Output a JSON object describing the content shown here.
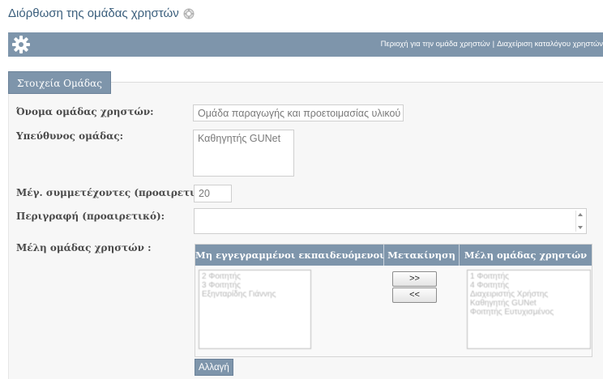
{
  "page": {
    "title": "Διόρθωση της ομάδας χρηστών"
  },
  "toolbar": {
    "link_area": "Περιοχή για την ομάδα χρηστών",
    "separator": "|",
    "link_manage": "Διαχείριση καταλόγου χρηστών"
  },
  "form": {
    "legend": "Στοιχεία Ομάδας",
    "group_name_label": "Όνομα ομάδας χρηστών:",
    "group_name_value": "Ομάδα παραγωγής και προετοιμασίας υλικού",
    "tutor_label": "Υπεύθυνος ομάδας:",
    "tutor_value": "Καθηγητής GUNet",
    "max_label": "Μέγ. συμμετέχοντες (προαιρετικό):",
    "max_value": "20",
    "description_label": "Περιγραφή (προαιρετικό):",
    "description_value": "",
    "members_label": "Μέλη ομάδας χρηστών :",
    "submit_label": "Αλλαγή"
  },
  "members": {
    "col_unregistered": "Μη εγγεγραμμένοι εκπαιδευόμενοι",
    "col_move": "Μετακίνηση",
    "col_members": "Μέλη ομάδας χρηστών",
    "add_button": ">>",
    "remove_button": "<<",
    "unregistered": [
      "2 Φοιτητής",
      "3 Φοιτητής",
      "Εξηνταρίδης Γιάννης"
    ],
    "group_members": [
      "1 Φοιτητής",
      "4 Φοιτητής",
      "Διαχειριστής Χρήστης",
      "Καθηγητής GUNet",
      "Φοιτητής Ευτυχισμένος"
    ]
  },
  "icons": {
    "help": "help-icon",
    "settings": "gear-icon"
  },
  "colors": {
    "header_bar": "#7e95ab",
    "title_text": "#3b5f7d"
  }
}
